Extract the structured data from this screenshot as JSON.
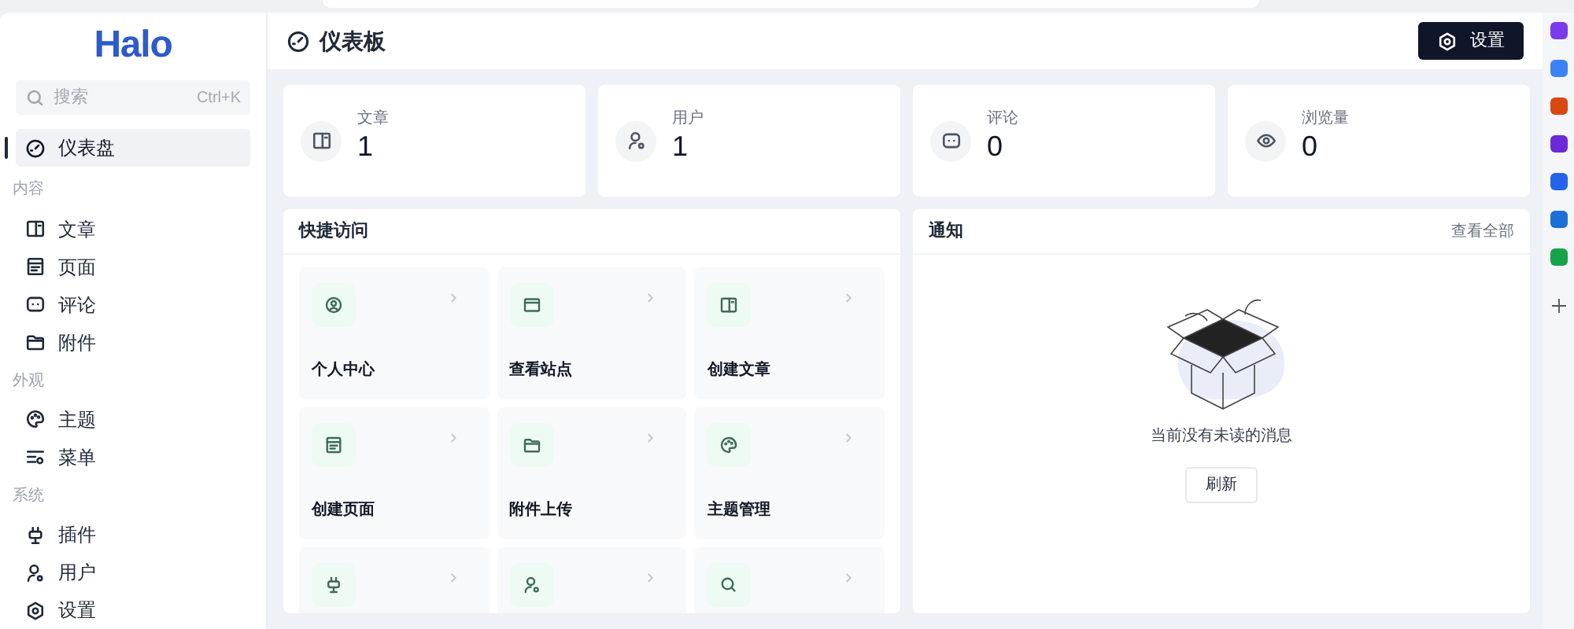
{
  "sidebar": {
    "logo": "Halo",
    "search": {
      "placeholder": "搜索",
      "shortcut": "Ctrl+K"
    },
    "sections": [
      {
        "items": [
          {
            "label": "仪表盘",
            "selected": true
          }
        ]
      },
      {
        "heading": "内容",
        "items": [
          {
            "label": "文章",
            "selected": false
          },
          {
            "label": "页面",
            "selected": false
          },
          {
            "label": "评论",
            "selected": false
          },
          {
            "label": "附件",
            "selected": false
          }
        ]
      },
      {
        "heading": "外观",
        "items": [
          {
            "label": "主题",
            "selected": false
          },
          {
            "label": "菜单",
            "selected": false
          }
        ]
      },
      {
        "heading": "系统",
        "items": [
          {
            "label": "插件",
            "selected": false
          },
          {
            "label": "用户",
            "selected": false
          },
          {
            "label": "设置",
            "selected": false
          }
        ]
      }
    ]
  },
  "header": {
    "title": "仪表板",
    "button": "设置"
  },
  "stats": [
    {
      "label": "文章",
      "value": "1"
    },
    {
      "label": "用户",
      "value": "1"
    },
    {
      "label": "评论",
      "value": "0"
    },
    {
      "label": "浏览量",
      "value": "0"
    }
  ],
  "quick_access": {
    "title": "快捷访问",
    "items": [
      {
        "kind": "tile",
        "label": "个人中心"
      },
      {
        "kind": "tile",
        "label": "查看站点"
      },
      {
        "kind": "tile",
        "label": "创建文章"
      },
      {
        "kind": "tile",
        "label": "创建页面"
      },
      {
        "kind": "tile",
        "label": "附件上传"
      },
      {
        "kind": "tile",
        "label": "主题管理"
      },
      {
        "kind": "tile"
      },
      {
        "kind": "tile"
      },
      {
        "kind": "tile"
      }
    ]
  },
  "notifications": {
    "title": "通知",
    "view_all": "查看全部",
    "empty_message": "当前没有未读的消息",
    "refresh": "刷新"
  }
}
